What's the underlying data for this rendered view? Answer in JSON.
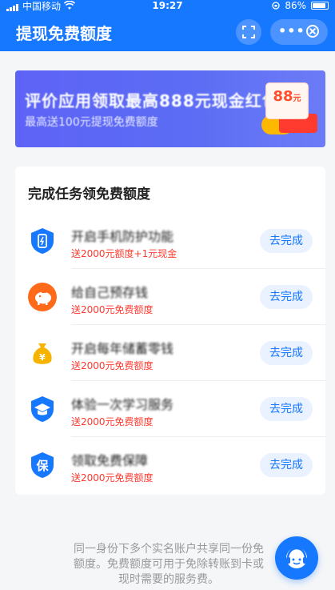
{
  "status_bar": {
    "carrier": "中国移动",
    "time": "19:27",
    "battery": "86%"
  },
  "nav": {
    "title": "提现免费额度",
    "more_label": "•••"
  },
  "banner": {
    "headline": "评价应用领取最高888元现金红包",
    "subline": "最高送100元提现免费额度",
    "coupon_amount": "88",
    "coupon_unit": "元"
  },
  "tasks_card": {
    "title": "完成任务领免费额度",
    "tasks": [
      {
        "name": "开启手机防护功能",
        "reward": "送2000元额度+1元现金",
        "button": "去完成",
        "icon": "shield-phone-icon",
        "color": "#1677ff"
      },
      {
        "name": "给自己预存钱",
        "reward": "送2000元免费额度",
        "button": "去完成",
        "icon": "piggy-bank-icon",
        "color": "#ff6a1a"
      },
      {
        "name": "开启每年储蓄零钱",
        "reward": "送2000元免费额度",
        "button": "去完成",
        "icon": "money-bag-icon",
        "color": "#f6b400"
      },
      {
        "name": "体验一次学习服务",
        "reward": "送2000元免费额度",
        "button": "去完成",
        "icon": "graduation-shield-icon",
        "color": "#1677ff"
      },
      {
        "name": "领取免费保障",
        "reward": "送2000元免费额度",
        "button": "去完成",
        "icon": "insurance-shield-icon",
        "color": "#1677ff"
      }
    ]
  },
  "footer": {
    "line1": "同一身份下多个实名账户共享同一份免",
    "line2": "额度。免费额度可用于免除转账到卡或",
    "line3": "现时需要的服务费。"
  },
  "colors": {
    "primary": "#1677ff",
    "reward_red": "#ff3b30",
    "banner_purple": "#5d63f6"
  }
}
